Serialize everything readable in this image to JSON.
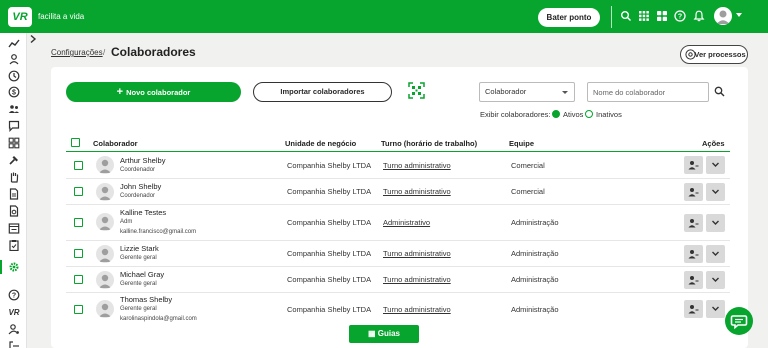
{
  "topbar": {
    "logo_text": "VR",
    "tagline": "facilita a vida",
    "punch_button": "Bater ponto",
    "icons": [
      "search-icon",
      "grid-icon",
      "apps-icon",
      "help-icon",
      "bell-icon",
      "user-avatar"
    ]
  },
  "sidebar": {
    "items": [
      "trend-icon",
      "person-icon",
      "clock-icon",
      "money-icon",
      "team-icon",
      "chat-icon",
      "dashboard-icon",
      "tools-icon",
      "hand-icon",
      "document-icon",
      "report-icon",
      "calendar-icon",
      "clipboard-icon",
      "settings-icon",
      "help-icon",
      "vr-icon",
      "user-settings-icon",
      "logout-icon"
    ],
    "active": "settings-icon"
  },
  "breadcrumb": {
    "parent": "Configurações",
    "separator": "/",
    "current": "Colaboradores"
  },
  "header": {
    "processes_button": "Ver processos"
  },
  "toolbar": {
    "new_button": "Novo colaborador",
    "import_button": "Importar colaboradores",
    "filter_select": "Colaborador",
    "search_placeholder": "Nome do colaborador",
    "show_label": "Exibir colaboradores:",
    "radio_active": "Ativos",
    "radio_inactive": "Inativos"
  },
  "table": {
    "headers": {
      "name": "Colaborador",
      "unit": "Unidade de negócio",
      "shift": "Turno (horário de trabalho)",
      "team": "Equipe",
      "actions": "Ações"
    },
    "rows": [
      {
        "name": "Arthur Shelby",
        "role": "Coordenador",
        "email": "",
        "unit": "Companhia Shelby LTDA",
        "shift": "Turno administrativo",
        "team": "Comercial"
      },
      {
        "name": "John Shelby",
        "role": "Coordenador",
        "email": "",
        "unit": "Companhia Shelby LTDA",
        "shift": "Turno administrativo",
        "team": "Comercial"
      },
      {
        "name": "Kalline Testes",
        "role": "Adm",
        "email": "kalline.francisco@gmail.com",
        "unit": "Companhia Shelby LTDA",
        "shift": "Administrativo",
        "team": "Administração"
      },
      {
        "name": "Lizzie Stark",
        "role": "Gerente geral",
        "email": "",
        "unit": "Companhia Shelby LTDA",
        "shift": "Turno administrativo",
        "team": "Administração"
      },
      {
        "name": "Michael Gray",
        "role": "Gerente geral",
        "email": "",
        "unit": "Companhia Shelby LTDA",
        "shift": "Turno administrativo",
        "team": "Administração"
      },
      {
        "name": "Thomas Shelby",
        "role": "Gerente geral",
        "email": "karolinaspindola@gmail.com",
        "unit": "Companhia Shelby LTDA",
        "shift": "Turno administrativo",
        "team": "Administração"
      }
    ]
  },
  "footer": {
    "guides_button": "Guias"
  },
  "colors": {
    "brand": "#07a42e",
    "background": "#f1f1ef",
    "action_button": "#d9d9d9"
  }
}
